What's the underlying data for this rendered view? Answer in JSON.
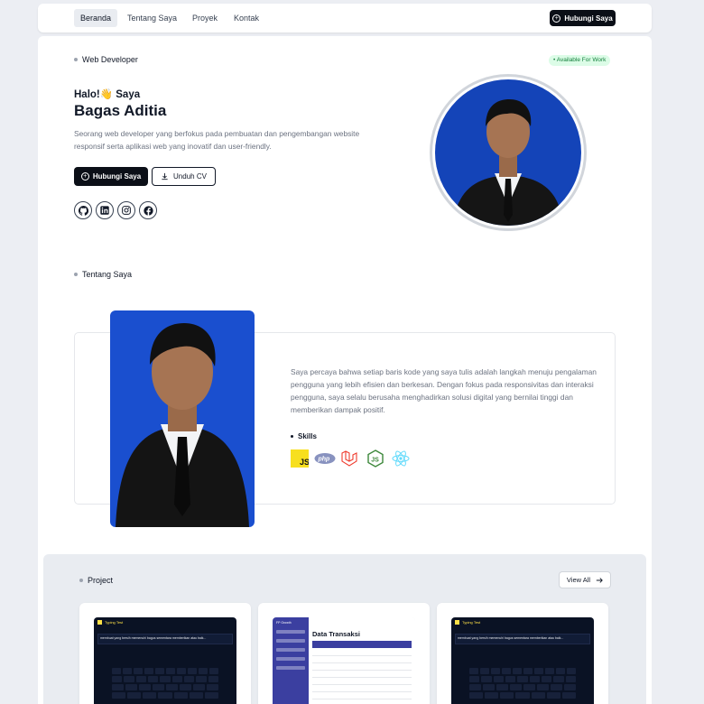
{
  "nav": {
    "items": [
      {
        "label": "Beranda",
        "active": true
      },
      {
        "label": "Tentang Saya",
        "active": false
      },
      {
        "label": "Proyek",
        "active": false
      },
      {
        "label": "Kontak",
        "active": false
      }
    ],
    "cta_label": "Hubungi Saya"
  },
  "hero": {
    "role": "Web Developer",
    "badge": "• Available For Work",
    "greeting": "Halo!👋 Saya",
    "name": "Bagas Aditia",
    "description": "Seorang web developer yang berfokus pada pembuatan dan pengembangan website responsif serta aplikasi web yang inovatif dan user-friendly.",
    "primary_button": "Hubungi Saya",
    "secondary_button": "Unduh CV",
    "socials": [
      "github-icon",
      "linkedin-icon",
      "instagram-icon",
      "facebook-icon"
    ]
  },
  "about": {
    "heading": "Tentang Saya",
    "text": "Saya percaya bahwa setiap baris kode yang saya tulis adalah langkah menuju pengalaman pengguna yang lebih efisien dan berkesan. Dengan fokus pada responsivitas dan interaksi pengguna, saya selalu berusaha menghadirkan solusi digital yang bernilai tinggi dan memberikan dampak positif.",
    "skills_heading": "Skills",
    "skills": [
      "js-icon",
      "php-icon",
      "laravel-icon",
      "nodejs-icon",
      "react-icon"
    ]
  },
  "projects": {
    "heading": "Project",
    "view_all": "View All",
    "cards": [
      {
        "app_title": "Typing Test",
        "typed": "membuat yang bersih memenuhi bagus sementara memberikan atau baik..."
      },
      {
        "app_title": "FP Growth",
        "screen_title": "Data Transaksi"
      },
      {
        "app_title": "Typing Test",
        "typed": "membuat yang bersih memenuhi bagus sementara memberikan atau baik..."
      }
    ]
  },
  "colors": {
    "accent_dark": "#0b0f17",
    "photo_blue": "#1444b8",
    "available_green": "#15803d"
  }
}
